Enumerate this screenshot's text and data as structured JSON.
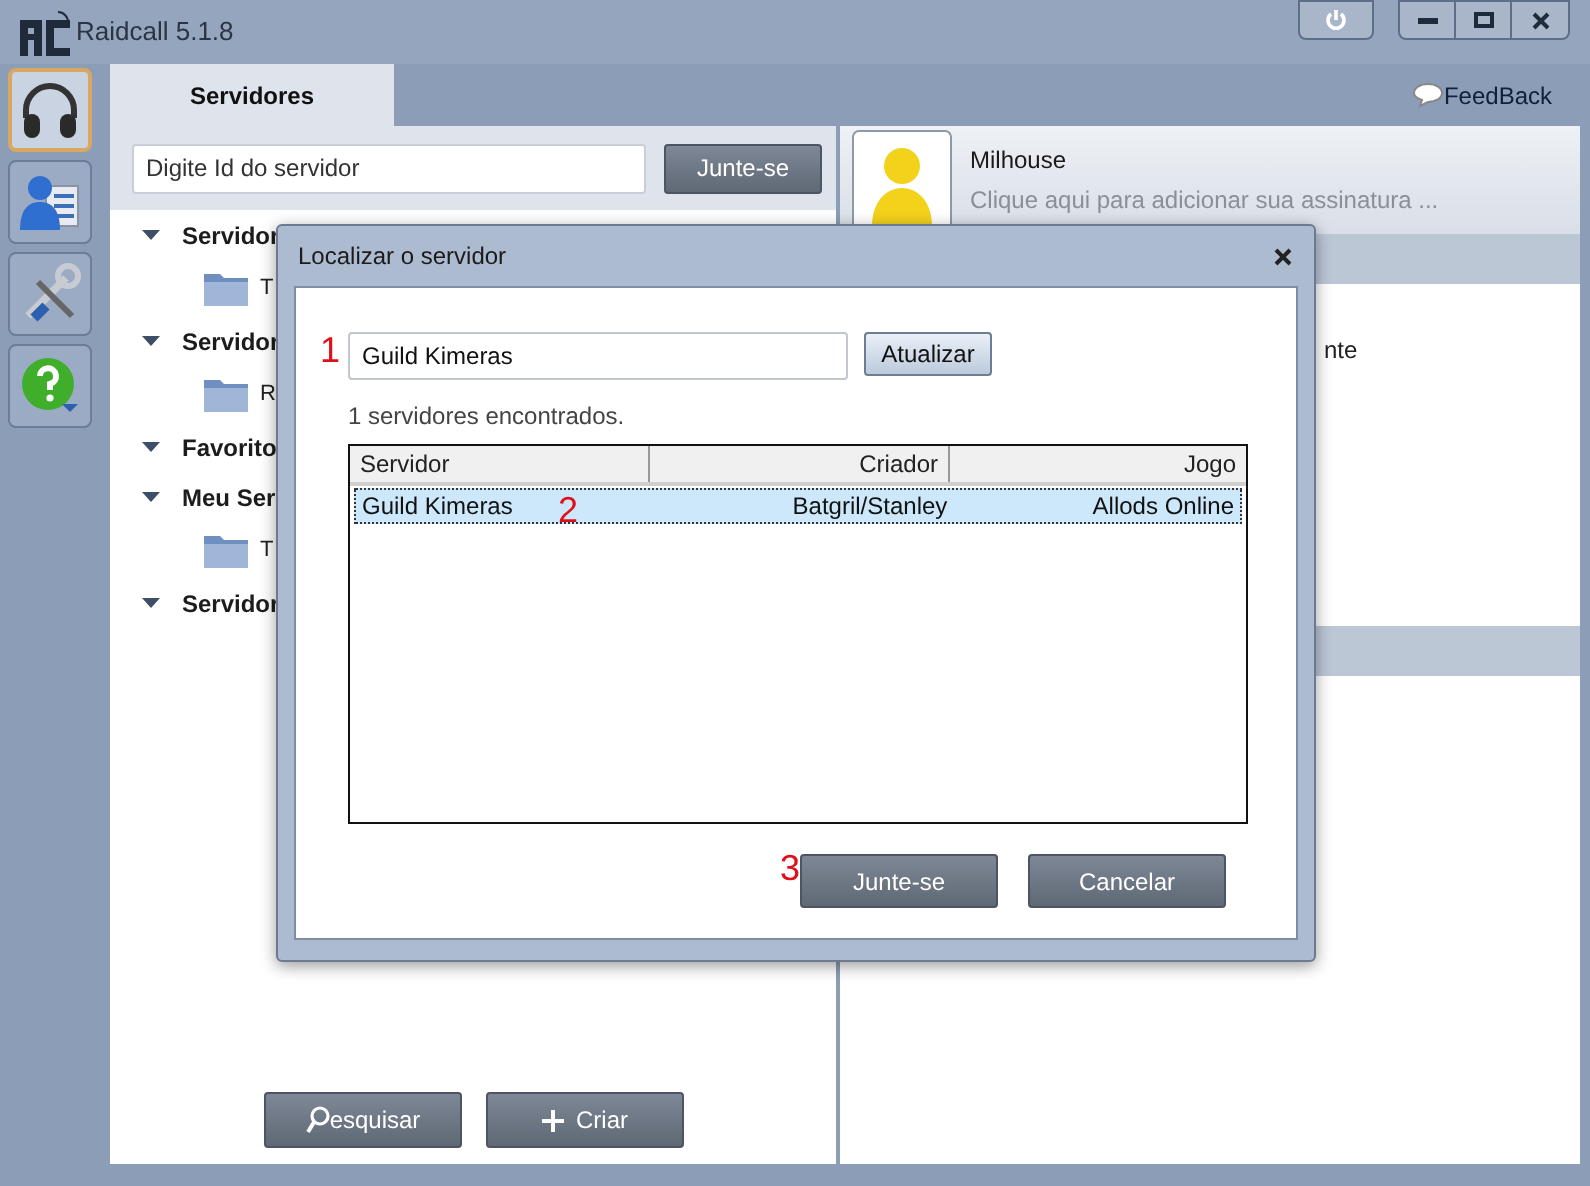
{
  "window": {
    "title": "Raidcall 5.1.8"
  },
  "rail": [
    {
      "kind": "headset",
      "selected": true
    },
    {
      "kind": "contacts",
      "selected": false
    },
    {
      "kind": "tools",
      "selected": false
    },
    {
      "kind": "help",
      "selected": false
    }
  ],
  "tabs": [
    {
      "label": "Servidores",
      "selected": true
    }
  ],
  "feedback": "FeedBack",
  "server_search": {
    "placeholder": "Digite Id do servidor",
    "button": "Junte-se"
  },
  "tree": [
    {
      "label": "Servidor",
      "expanded": true,
      "children": [
        {
          "label": "T"
        }
      ]
    },
    {
      "label": "Servidor",
      "expanded": true,
      "children": [
        {
          "label": "R"
        }
      ]
    },
    {
      "label": "Favorito",
      "expanded": true
    },
    {
      "label": "Meu Ser",
      "expanded": true,
      "children": [
        {
          "label": "T"
        }
      ]
    },
    {
      "label": "Servidor",
      "expanded": true
    }
  ],
  "bottom_buttons": [
    {
      "kind": "search",
      "label": "esquisar"
    },
    {
      "kind": "add",
      "label": "Criar"
    }
  ],
  "profile": {
    "name": "Milhouse",
    "signature": "Clique aqui para adicionar sua assinatura ..."
  },
  "right_text": "nte",
  "dialog": {
    "title": "Localizar o servidor",
    "query": "Guild Kimeras",
    "refresh_button": "Atualizar",
    "result_count": "1 servidores encontrados.",
    "table": {
      "columns": [
        {
          "label": "Servidor"
        },
        {
          "label": "Criador"
        },
        {
          "label": "Jogo"
        }
      ],
      "rows": [
        {
          "cells": [
            "Guild Kimeras",
            "Batgril/Stanley",
            "Allods Online"
          ],
          "selected": true
        }
      ]
    },
    "buttons": [
      "Junte-se",
      "Cancelar"
    ]
  },
  "annotations": [
    "1",
    "2",
    "3"
  ]
}
